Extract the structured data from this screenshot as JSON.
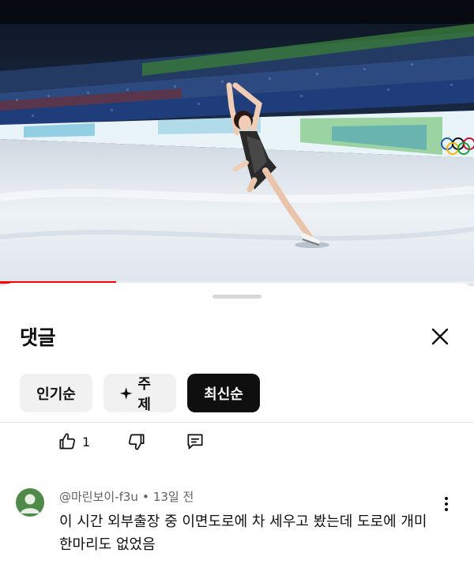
{
  "video": {
    "progress_fraction": 0.245,
    "progress_color": "#ff0000"
  },
  "sheet": {
    "title": "댓글",
    "close_icon": "close-icon"
  },
  "filters": {
    "popular": "인기순",
    "topics": "주제",
    "topics_icon": "sparkle-icon",
    "latest": "최신순",
    "active": "latest"
  },
  "prev_comment_actions": {
    "like_count": "1",
    "like_icon": "thumbs-up-icon",
    "dislike_icon": "thumbs-down-icon",
    "reply_icon": "reply-icon"
  },
  "comment": {
    "author": "@마린보이-f3u",
    "separator": "•",
    "time": "13일 전",
    "text": "이 시간 외부출장 중 이면도로에 차 세우고 봤는데 도로에 개미 한마리도 없었음",
    "avatar_color": "#4f8a4a",
    "menu_icon": "more-vert-icon"
  }
}
